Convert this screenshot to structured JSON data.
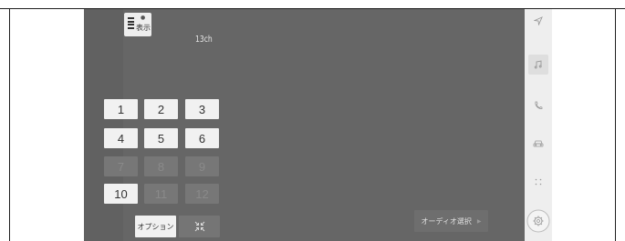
{
  "display_button": {
    "label": "表示"
  },
  "channel": {
    "label": "13ch"
  },
  "keypad": {
    "keys": [
      {
        "label": "1",
        "enabled": true
      },
      {
        "label": "2",
        "enabled": true
      },
      {
        "label": "3",
        "enabled": true
      },
      {
        "label": "4",
        "enabled": true
      },
      {
        "label": "5",
        "enabled": true
      },
      {
        "label": "6",
        "enabled": true
      },
      {
        "label": "7",
        "enabled": false
      },
      {
        "label": "8",
        "enabled": false
      },
      {
        "label": "9",
        "enabled": false
      },
      {
        "label": "10",
        "enabled": true
      },
      {
        "label": "11",
        "enabled": false
      },
      {
        "label": "12",
        "enabled": false
      }
    ]
  },
  "options_button": {
    "label": "オプション"
  },
  "collapse_button": {
    "icon": "collapse-icon"
  },
  "audio_select_button": {
    "label": "オーディオ選択",
    "icon": "chevron-right-icon"
  },
  "side_rail": {
    "items": [
      {
        "icon": "navigation-icon"
      },
      {
        "icon": "music-icon",
        "selected": true
      },
      {
        "icon": "phone-icon"
      },
      {
        "icon": "car-icon"
      },
      {
        "icon": "apps-icon"
      },
      {
        "icon": "settings-icon"
      }
    ]
  },
  "colors": {
    "screen_bg": "#666666",
    "key_enabled": "#f1f1f1",
    "key_disabled": "#777777",
    "rail_bg": "#eeeeee"
  }
}
